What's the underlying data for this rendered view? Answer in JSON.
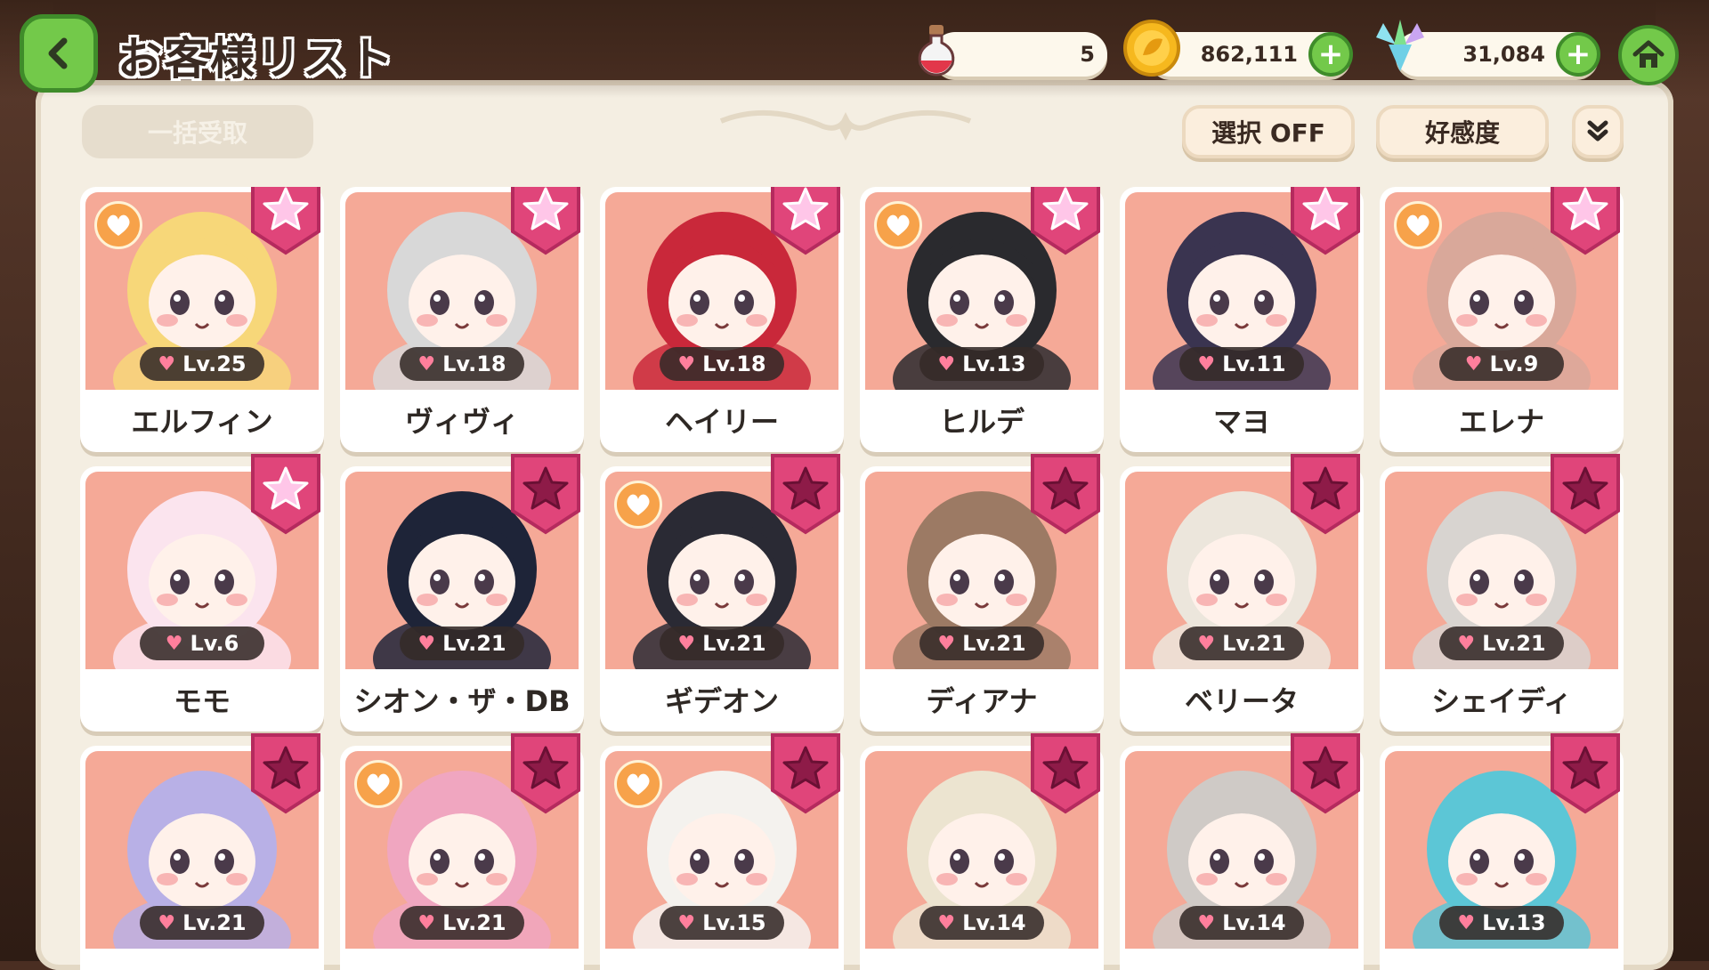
{
  "title": "お客様リスト",
  "currencies": {
    "potion": {
      "value": "5",
      "icon": "potion-icon"
    },
    "gold": {
      "value": "862,111",
      "icon": "gold-coin-icon"
    },
    "gem": {
      "value": "31,084",
      "icon": "gem-icon"
    }
  },
  "toolbar": {
    "bulk_receive_label": "一括受取",
    "select_label": "選択 OFF",
    "sort_label": "好感度"
  },
  "colors": {
    "accent_green": "#73c94a",
    "portrait_bg": "#f5a997",
    "ribbon_pink": "#e0457a",
    "favorite_orange": "#f7a24a"
  },
  "customers": [
    {
      "name": "エルフィン",
      "level": "Lv.25",
      "starred": true,
      "favorite": true,
      "hair": "#f7d779"
    },
    {
      "name": "ヴィヴィ",
      "level": "Lv.18",
      "starred": true,
      "favorite": false,
      "hair": "#d8d8d8"
    },
    {
      "name": "ヘイリー",
      "level": "Lv.18",
      "starred": true,
      "favorite": false,
      "hair": "#c9283a"
    },
    {
      "name": "ヒルデ",
      "level": "Lv.13",
      "starred": true,
      "favorite": true,
      "hair": "#2a2a2e"
    },
    {
      "name": "マヨ",
      "level": "Lv.11",
      "starred": true,
      "favorite": false,
      "hair": "#3a3450"
    },
    {
      "name": "エレナ",
      "level": "Lv.9",
      "starred": true,
      "favorite": true,
      "hair": "#d9a89a"
    },
    {
      "name": "モモ",
      "level": "Lv.6",
      "starred": true,
      "favorite": false,
      "hair": "#fbe4ee"
    },
    {
      "name": "シオン・ザ・DB",
      "level": "Lv.21",
      "starred": false,
      "favorite": false,
      "hair": "#1e2438"
    },
    {
      "name": "ギデオン",
      "level": "Lv.21",
      "starred": false,
      "favorite": true,
      "hair": "#2a2a34"
    },
    {
      "name": "ディアナ",
      "level": "Lv.21",
      "starred": false,
      "favorite": false,
      "hair": "#9c7a64"
    },
    {
      "name": "ベリータ",
      "level": "Lv.21",
      "starred": false,
      "favorite": false,
      "hair": "#ece6dc"
    },
    {
      "name": "シェイディ",
      "level": "Lv.21",
      "starred": false,
      "favorite": false,
      "hair": "#d8d4d0"
    },
    {
      "name": "",
      "level": "Lv.21",
      "starred": false,
      "favorite": false,
      "hair": "#b8b0e6"
    },
    {
      "name": "",
      "level": "Lv.21",
      "starred": false,
      "favorite": true,
      "hair": "#f0a6c0"
    },
    {
      "name": "",
      "level": "Lv.15",
      "starred": false,
      "favorite": true,
      "hair": "#f4f2ee"
    },
    {
      "name": "",
      "level": "Lv.14",
      "starred": false,
      "favorite": false,
      "hair": "#ece4d0"
    },
    {
      "name": "",
      "level": "Lv.14",
      "starred": false,
      "favorite": false,
      "hair": "#cfcac6"
    },
    {
      "name": "",
      "level": "Lv.13",
      "starred": false,
      "favorite": false,
      "hair": "#5cc6d6"
    }
  ]
}
